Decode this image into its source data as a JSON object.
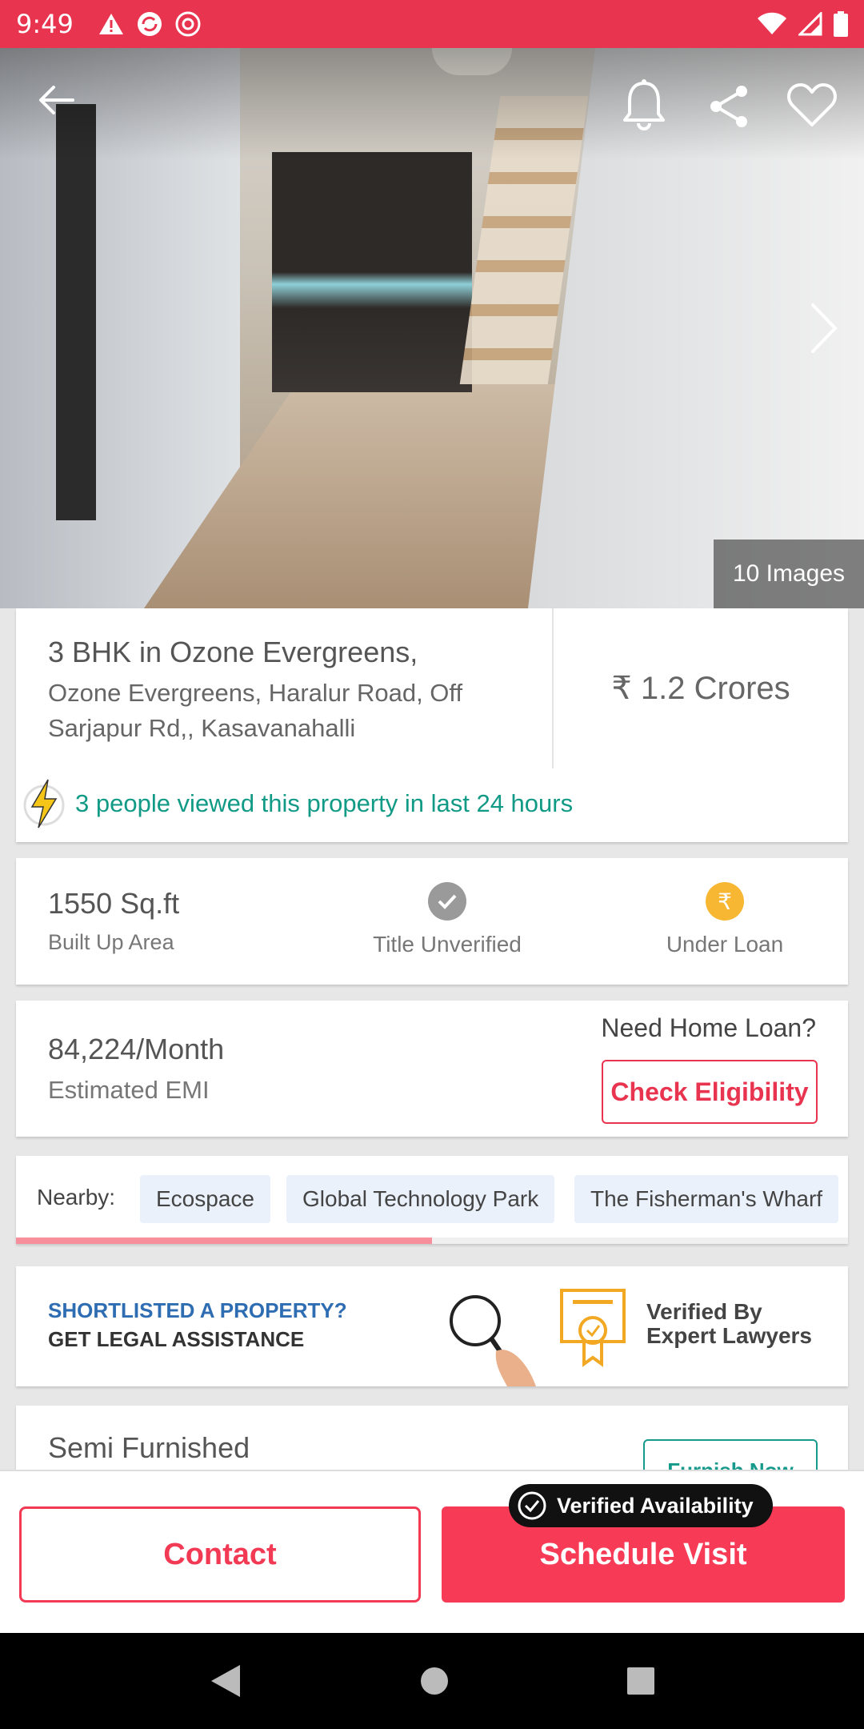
{
  "status_bar": {
    "time": "9:49"
  },
  "hero": {
    "images_count_label": "10 Images"
  },
  "listing": {
    "title": "3 BHK in Ozone Evergreens,",
    "address": "Ozone Evergreens, Haralur Road, Off Sarjapur Rd,, Kasavanahalli",
    "price": "₹ 1.2 Crores",
    "views_notice": "3 people viewed this property in last 24 hours"
  },
  "area": {
    "value": "1550 Sq.ft",
    "label": "Built Up Area",
    "title_status": "Title Unverified",
    "loan_status": "Under Loan"
  },
  "emi": {
    "value": "84,224/Month",
    "label": "Estimated EMI",
    "loan_prompt": "Need Home Loan?",
    "check_button": "Check Eligibility"
  },
  "nearby": {
    "label": "Nearby:",
    "places": [
      "Ecospace",
      "Global Technology Park",
      "The Fisherman's Wharf"
    ],
    "scroll_progress": 0.5
  },
  "legal": {
    "question": "SHORTLISTED A PROPERTY?",
    "cta": "GET LEGAL ASSISTANCE",
    "verified_line1": "Verified By",
    "verified_line2": "Expert Lawyers"
  },
  "furnishing": {
    "state": "Semi Furnished",
    "button": "Furnish Now"
  },
  "actions": {
    "contact": "Contact",
    "schedule": "Schedule Visit",
    "verified_badge": "Verified Availability"
  },
  "colors": {
    "brand_red": "#e8344f",
    "teal": "#119a85",
    "loan_yellow": "#f7b733",
    "unverified_grey": "#9a9a9a"
  }
}
